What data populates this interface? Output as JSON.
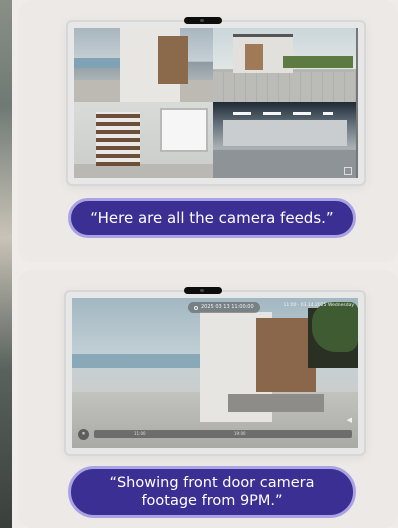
{
  "panels": {
    "top": {
      "caption": "“Here are all the camera feeds.”"
    },
    "bottom": {
      "caption_line1": "“Showing front door camera",
      "caption_line2": "footage from 9PM.”",
      "date_label": "2025 03 13 11:00:00",
      "top_right_time": "11:00 · 03.14.2025 Wednesday",
      "timeline_ticks": [
        "11:00",
        "19:00"
      ]
    }
  },
  "icons": {
    "play": "⏸",
    "volume": "◀"
  },
  "colors": {
    "bubble_fill": "#3b2f93",
    "bubble_border": "#a9a3e4",
    "panel_bg": "#ece9e6"
  }
}
